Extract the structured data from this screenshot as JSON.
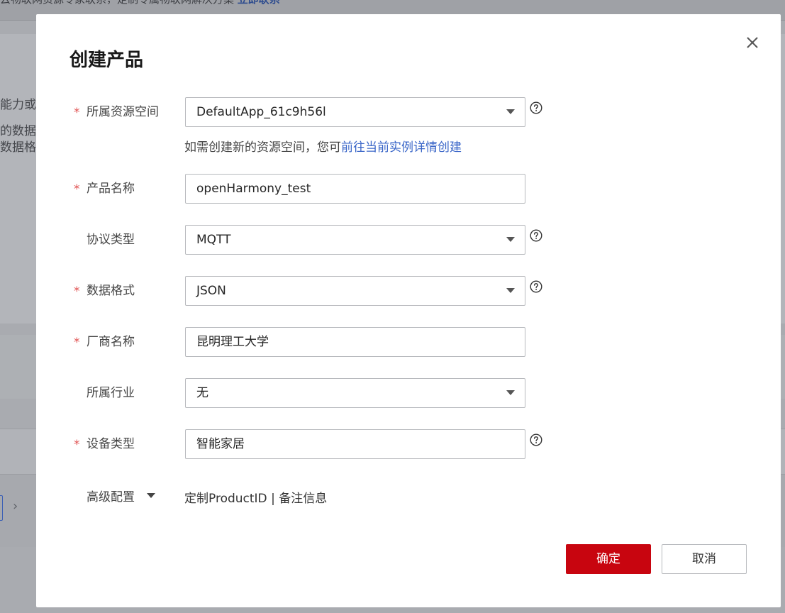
{
  "background": {
    "top_text": "云物联网资源专家联系，定制专属物联网解决方案",
    "top_link": "立即联系",
    "side_texts": [
      "能力或特",
      "的数据信",
      "数据格"
    ]
  },
  "dialog": {
    "title": "创建产品",
    "required_mark": "*",
    "fields": {
      "resource_space": {
        "label": "所属资源空间",
        "value": "DefaultApp_61c9h56l"
      },
      "product_name": {
        "label": "产品名称",
        "value": "openHarmony_test"
      },
      "protocol": {
        "label": "协议类型",
        "value": "MQTT"
      },
      "data_format": {
        "label": "数据格式",
        "value": "JSON"
      },
      "vendor": {
        "label": "厂商名称",
        "value": "昆明理工大学"
      },
      "industry": {
        "label": "所属行业",
        "value": "无"
      },
      "device_type": {
        "label": "设备类型",
        "value": "智能家居"
      }
    },
    "hint_text": "如需创建新的资源空间，您可",
    "hint_link": "前往当前实例详情创建",
    "advanced": {
      "label": "高级配置",
      "custom_product_id": "定制ProductID",
      "separator": "|",
      "remark": "备注信息"
    },
    "ok_label": "确定",
    "cancel_label": "取消"
  },
  "icons": {
    "close": "close-icon",
    "help": "question-circle-icon",
    "dropdown": "caret-down-icon",
    "chevron": "chevron-right-icon"
  },
  "colors": {
    "primary": "#c8050f",
    "link": "#3a66c8",
    "required": "#e05050"
  }
}
